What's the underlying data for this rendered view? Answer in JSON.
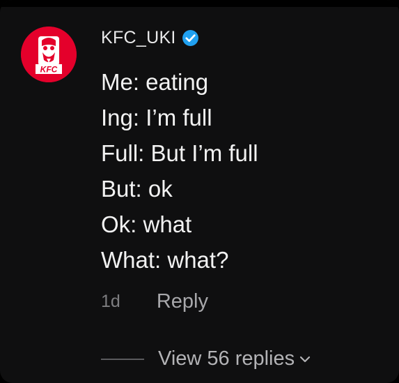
{
  "comment": {
    "author": "KFC_UKI",
    "avatar_label": "KFC",
    "verified_icon": "verified-check-icon",
    "lines": [
      "Me: eating",
      "Ing: I’m full",
      "Full: But I’m full",
      "But: ok",
      "Ok: what",
      "What: what?"
    ],
    "timestamp": "1d",
    "reply_label": "Reply",
    "view_replies_label": "View 56 replies",
    "colors": {
      "background": "#0f0f10",
      "avatar_red": "#e4002b",
      "verified_blue": "#20a0f0"
    }
  }
}
